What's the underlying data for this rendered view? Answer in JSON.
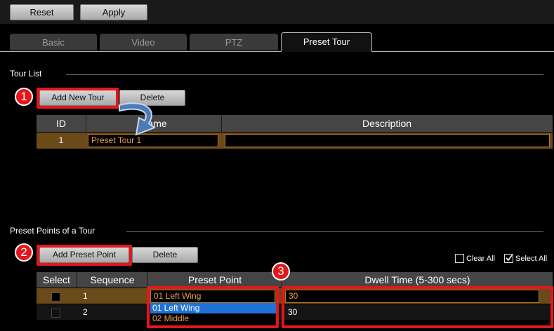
{
  "toolbar": {
    "reset_label": "Reset",
    "apply_label": "Apply"
  },
  "tabs": [
    {
      "label": "Basic",
      "active": false
    },
    {
      "label": "Video",
      "active": false
    },
    {
      "label": "PTZ",
      "active": false
    },
    {
      "label": "Preset Tour",
      "active": true
    }
  ],
  "tour_list": {
    "title": "Tour List",
    "add_label": "Add New Tour",
    "delete_label": "Delete",
    "columns": [
      "ID",
      "Name",
      "Description"
    ],
    "rows": [
      {
        "id": "1",
        "name": "Preset Tour 1",
        "description": ""
      }
    ]
  },
  "preset_points": {
    "title": "Preset Points of a Tour",
    "add_label": "Add Preset Point",
    "delete_label": "Delete",
    "clear_all_label": "Clear All",
    "select_all_label": "Select All",
    "columns": [
      "Select",
      "Sequence",
      "Preset Point",
      "Dwell Time (5-300 secs)"
    ],
    "rows": [
      {
        "sequence": "1",
        "preset_point": "01 Left Wing",
        "dwell": "30",
        "selected": true
      },
      {
        "sequence": "2",
        "preset_point": "",
        "dwell": "30",
        "selected": false
      }
    ],
    "dropdown_options": [
      "01 Left Wing",
      "02 Middle"
    ]
  },
  "callouts": [
    "1",
    "2",
    "3"
  ],
  "colors": {
    "accent_red": "#e3171b",
    "row_highlight": "#6b4a1a",
    "orange_text": "#e8a04a"
  }
}
